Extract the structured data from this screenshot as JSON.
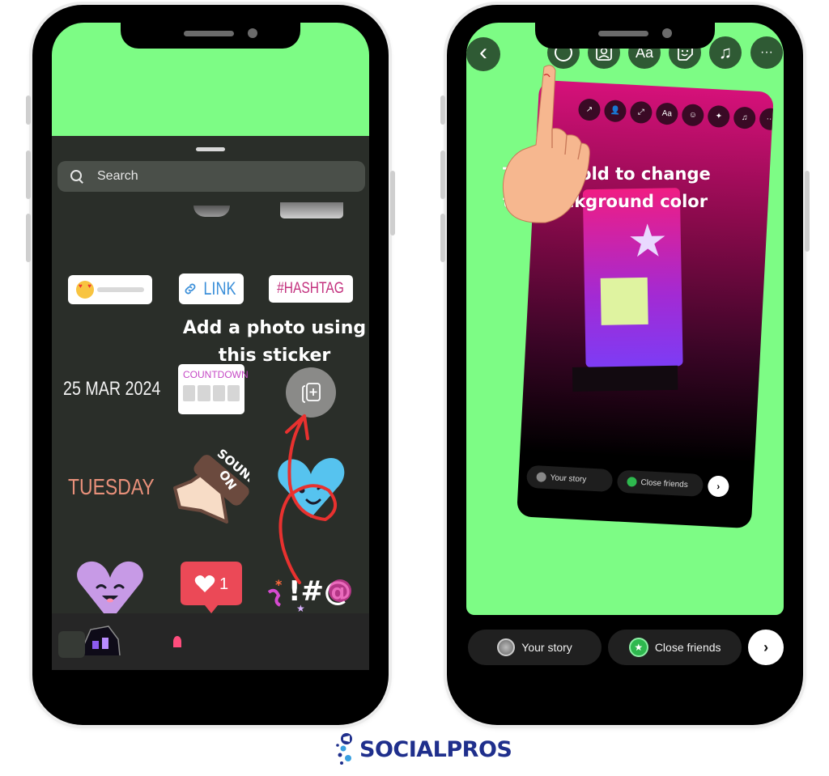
{
  "left_phone": {
    "search": {
      "placeholder": "Search",
      "value": ""
    },
    "stickers": {
      "link_label": "LINK",
      "hashtag_label": "#HASHTAG",
      "date_label": "25 MAR 2024",
      "countdown_label": "COUNTDOWN",
      "day_label": "TUESDAY",
      "sound_label_line1": "SOUND",
      "sound_label_line2": "ON",
      "like_count": "1",
      "symbols_label": "!#@"
    },
    "annotation": "Add a photo using this sticker",
    "icons": {
      "add_photo": "photo-add-icon",
      "search": "search-icon",
      "link": "link-icon"
    }
  },
  "right_phone": {
    "toolbar": {
      "back": "‹",
      "items": [
        {
          "name": "color-circle",
          "glyph": "◯"
        },
        {
          "name": "person-frame",
          "glyph": "👤"
        },
        {
          "name": "text",
          "glyph": "Aa"
        },
        {
          "name": "sticker",
          "glyph": "☺"
        },
        {
          "name": "music",
          "glyph": "♫"
        },
        {
          "name": "more",
          "glyph": "···"
        }
      ]
    },
    "preview_toolbar": [
      "↗",
      "👤",
      "⤢",
      "Aa",
      "☺",
      "✦",
      "♫",
      "···"
    ],
    "annotation_line1": "Tap or hold to change",
    "annotation_line2": "the background color",
    "preview_share": {
      "your_story": "Your story",
      "close_friends": "Close friends",
      "next": "›"
    },
    "share": {
      "your_story": "Your story",
      "close_friends": "Close friends",
      "next": "›"
    }
  },
  "brand": {
    "name": "SOCIALPROS",
    "color": "#1f2f8c"
  },
  "colors": {
    "story_bg_green": "#7dfc85",
    "tray_bg": "#2a2e29",
    "annotation_arrow": "#e8312f",
    "close_friends_green": "#2eb84e"
  }
}
